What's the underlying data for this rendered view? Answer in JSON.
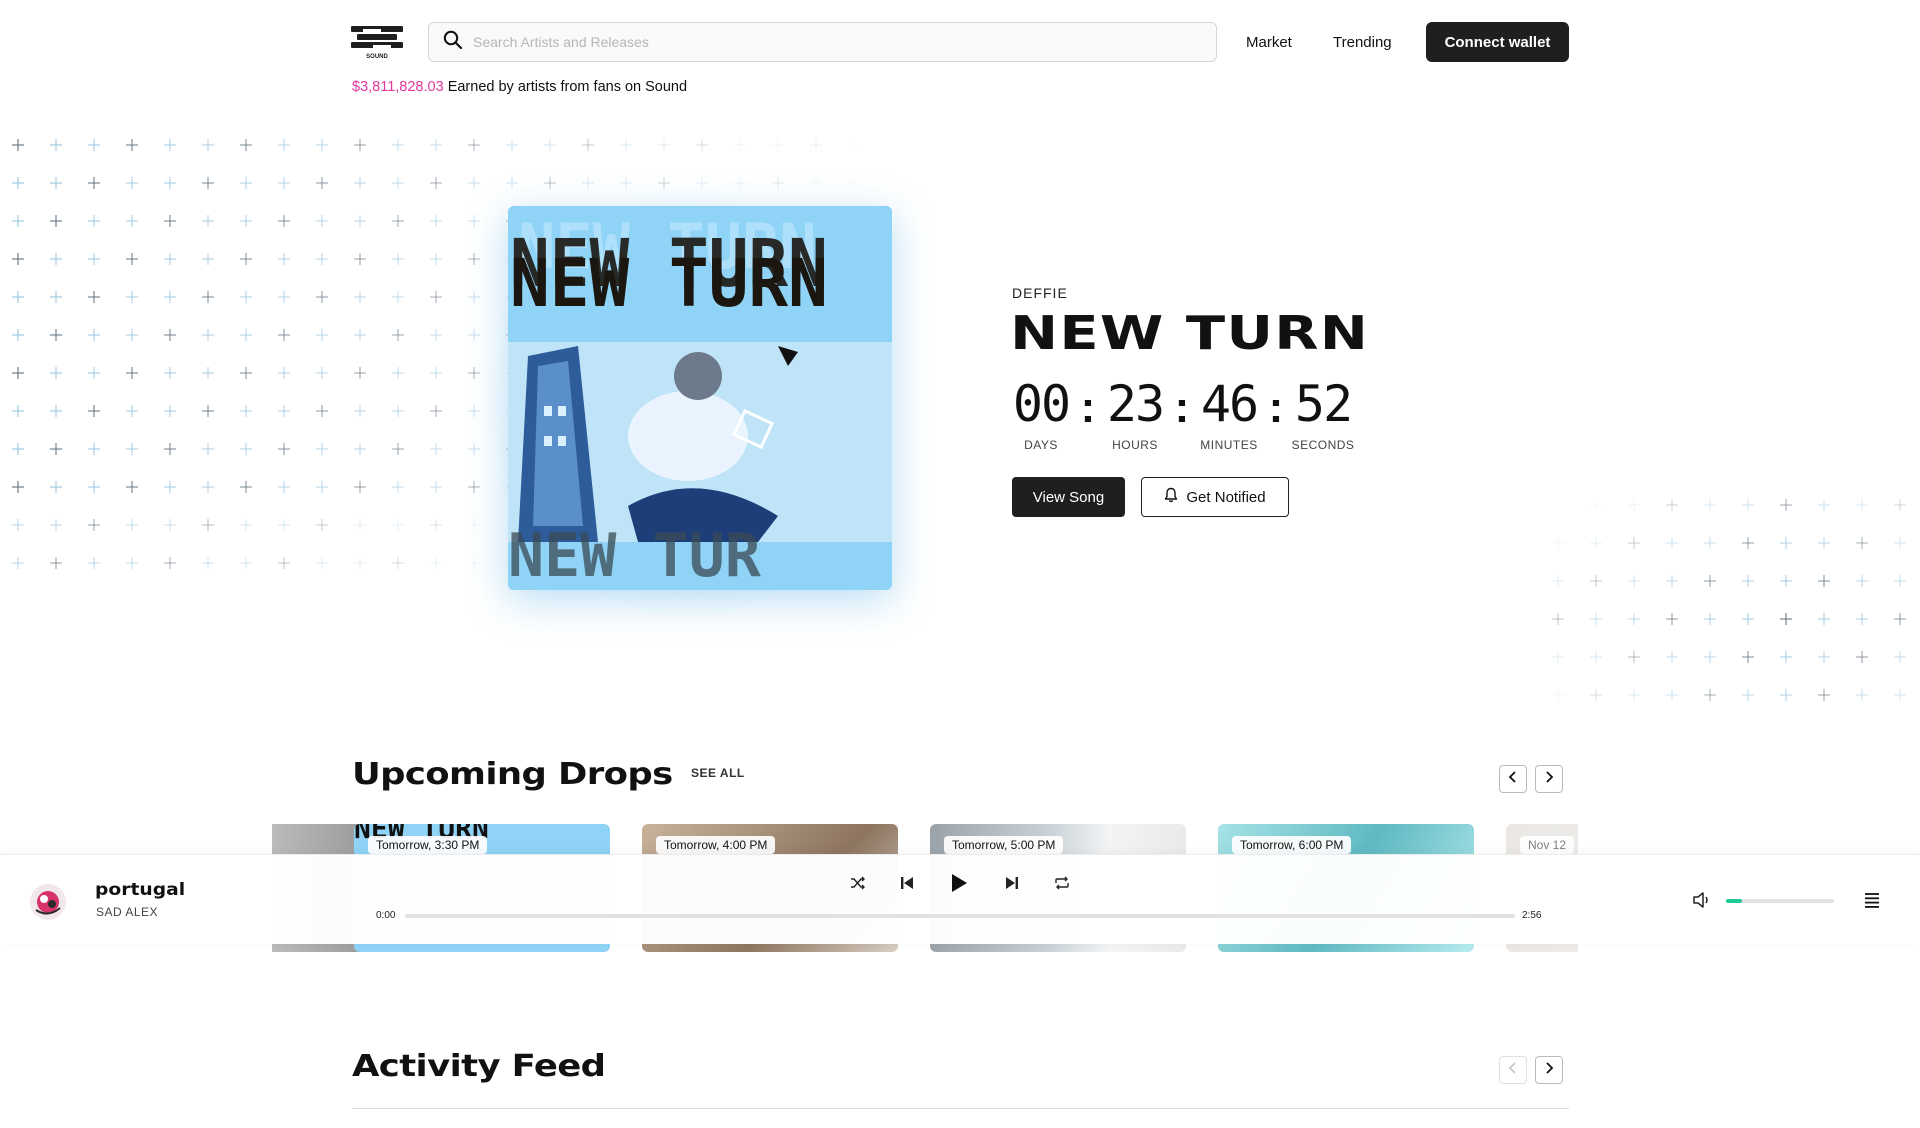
{
  "header": {
    "logo_text": "SOUND",
    "search_placeholder": "Search Artists and Releases",
    "nav": [
      "Market",
      "Trending"
    ],
    "connect_label": "Connect wallet"
  },
  "earned": {
    "amount": "$3,811,828.03",
    "text": "Earned by artists from fans on Sound"
  },
  "hero": {
    "artist": "DEFFIE",
    "title": "NEW TURN",
    "countdown": {
      "days": "00",
      "hours": "23",
      "minutes": "46",
      "seconds": "52",
      "labels": [
        "DAYS",
        "HOURS",
        "MINUTES",
        "SECONDS"
      ]
    },
    "view_label": "View Song",
    "notify_label": "Get Notified",
    "art_text": "NEW TURN"
  },
  "upcoming": {
    "title": "Upcoming Drops",
    "see_all": "SEE ALL",
    "drops": [
      {
        "time": "Tomorrow, 3:30 PM",
        "color": "#8fd3f6"
      },
      {
        "time": "Tomorrow, 4:00 PM",
        "color": "#b89f86"
      },
      {
        "time": "Tomorrow, 5:00 PM",
        "color": "#b9c4cb"
      },
      {
        "time": "Tomorrow, 6:00 PM",
        "color": "#7fcfd6"
      },
      {
        "time": "Nov 12",
        "color": "#c8c4c0"
      }
    ]
  },
  "player": {
    "track": "portugal",
    "artist": "SAD ALEX",
    "elapsed": "0:00",
    "duration": "2:56",
    "progress": 0,
    "volume": 0.15
  },
  "activity": {
    "title": "Activity Feed"
  },
  "colors": {
    "accent_pink": "#e13a9b",
    "volume_green": "#20c997",
    "dark": "#1f1f1f"
  }
}
